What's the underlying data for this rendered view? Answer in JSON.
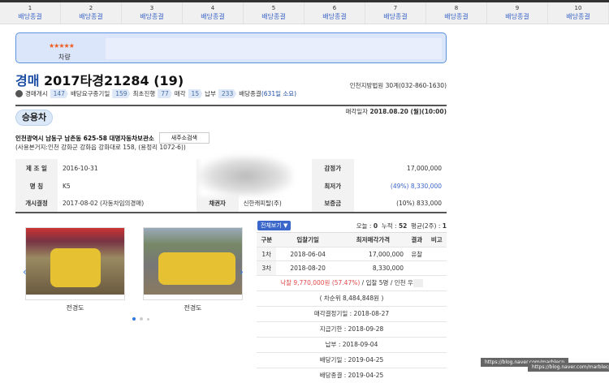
{
  "tabs": [
    {
      "num": "1",
      "label": "배당종결"
    },
    {
      "num": "2",
      "label": "배당종결"
    },
    {
      "num": "3",
      "label": "배당종결"
    },
    {
      "num": "4",
      "label": "배당종결"
    },
    {
      "num": "5",
      "label": "배당종결"
    },
    {
      "num": "6",
      "label": "배당종결"
    },
    {
      "num": "7",
      "label": "배당종결"
    },
    {
      "num": "8",
      "label": "배당종결"
    },
    {
      "num": "9",
      "label": "배당종결"
    },
    {
      "num": "10",
      "label": "배당종결"
    }
  ],
  "rating": {
    "stars": "★★★★★",
    "category": "차량",
    "star_color": "#f05a1e"
  },
  "case": {
    "prefix": "경매",
    "number": "2017타경21284 (19)",
    "court": "인천지방법원 30계(032-860-1630)"
  },
  "steps": [
    {
      "label": "경매개시",
      "value": "147"
    },
    {
      "label": "배당요구종기일",
      "value": "159"
    },
    {
      "label": "최초진행",
      "value": "77"
    },
    {
      "label": "매각",
      "value": "15"
    },
    {
      "label": "납부",
      "value": "233"
    }
  ],
  "steps_end": "배당종결",
  "steps_duration": "(631일 소요)",
  "sale_date_label": "매각일자",
  "sale_date": "2018.08.20 (월)(10:00)",
  "type": "승용차",
  "address": "인천광역시 남동구 남촌동 625-58 대명자동차보관소",
  "new_addr_btn": "새주소검색",
  "address_sub": "(사용본거지:인천 강화군 강화읍 강화대로 158, (용정리 1072-6))",
  "info": [
    [
      {
        "h": "제 조 일",
        "v": "2016-10-31"
      },
      {
        "h": "소유자",
        "v": ""
      },
      {
        "h": "감정가",
        "v": "17,000,000"
      }
    ],
    [
      {
        "h": "명 칭",
        "v": "K5"
      },
      {
        "h": "채무자",
        "v": ""
      },
      {
        "h": "최저가",
        "v": "(49%) 8,330,000"
      }
    ],
    [
      {
        "h": "개시결정",
        "v": "2017-08-02 (자동차임의경매)"
      },
      {
        "h": "채권자",
        "v": "신한캐피탈(주)"
      },
      {
        "h": "보증금",
        "v": "(10%) 833,000"
      }
    ]
  ],
  "photos": [
    {
      "caption": "전경도"
    },
    {
      "caption": "전경도"
    }
  ],
  "view_all": "전체보기 ▼",
  "stats": {
    "today_label": "오늘 : ",
    "today": "0",
    "total_label": "누적 : ",
    "total": "52",
    "avg_label": "평균(2주) : ",
    "avg": "1"
  },
  "bid_headers": [
    "구분",
    "입찰기일",
    "최저매각가격",
    "결과",
    "비고"
  ],
  "bids": [
    [
      "1차",
      "2018-06-04",
      "17,000,000",
      "유찰",
      ""
    ],
    [
      "3차",
      "2018-08-20",
      "8,330,000",
      "",
      ""
    ]
  ],
  "winning": "낙찰 9,770,000원 (57.47%)",
  "winning_rest": " / 입찰 5명 / 인천 우",
  "second": "( 차순위 8,484,848원 )",
  "dates": [
    "매각결정기일 : 2018-08-27",
    "지급기한 : 2018-09-28",
    "납부 : 2018-09-04",
    "배당기일 : 2019-04-25",
    "배당종결 : 2019-04-25"
  ],
  "watermark": "https://blog.naver.com/marblecp"
}
